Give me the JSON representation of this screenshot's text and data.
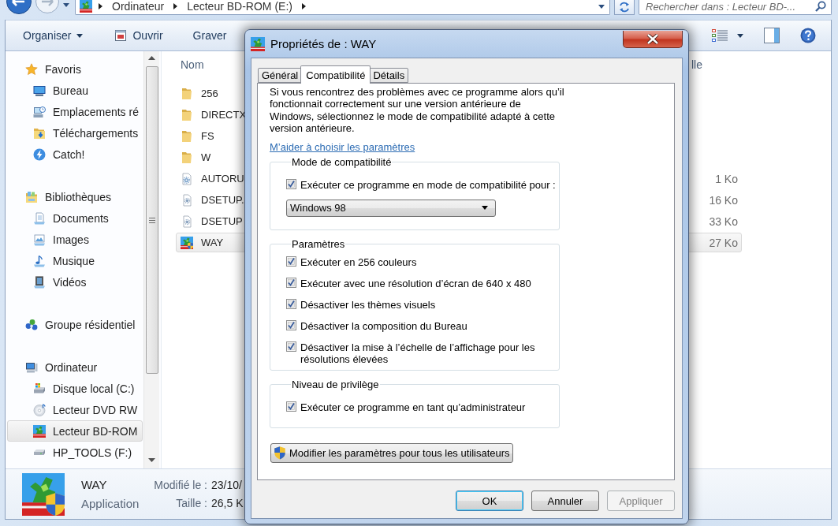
{
  "address_bar": {
    "crumbs": [
      "Ordinateur",
      "Lecteur BD-ROM (E:)"
    ],
    "search": {
      "placeholder": "Rechercher dans : Lecteur BD-..."
    }
  },
  "toolbar": {
    "items": [
      {
        "label": "Organiser",
        "kind": "menu"
      },
      {
        "label": "Ouvrir",
        "kind": "open"
      },
      {
        "label": "Graver",
        "kind": "plain"
      }
    ]
  },
  "sidebar": {
    "items": [
      {
        "label": "Favoris",
        "kind": "star",
        "selected": false,
        "children": [
          {
            "label": "Bureau",
            "kind": "desktop",
            "selected": false
          },
          {
            "label": "Emplacements ré",
            "kind": "recent",
            "selected": false
          },
          {
            "label": "Téléchargements",
            "kind": "downloads",
            "selected": false
          },
          {
            "label": "Catch!",
            "kind": "catch",
            "selected": false
          }
        ]
      },
      {
        "label": "Bibliothèques",
        "kind": "library",
        "selected": false,
        "children": [
          {
            "label": "Documents",
            "kind": "documents",
            "selected": false
          },
          {
            "label": "Images",
            "kind": "pictures",
            "selected": false
          },
          {
            "label": "Musique",
            "kind": "music",
            "selected": false
          },
          {
            "label": "Vidéos",
            "kind": "videos",
            "selected": false
          }
        ]
      },
      {
        "label": "Groupe résidentiel",
        "kind": "homegroup",
        "selected": false
      },
      {
        "label": "Ordinateur",
        "kind": "computer",
        "selected": false,
        "children": [
          {
            "label": "Disque local (C:)",
            "kind": "harddisk",
            "selected": false
          },
          {
            "label": "Lecteur DVD RW",
            "kind": "dvd",
            "selected": false
          },
          {
            "label": "Lecteur BD-ROM",
            "kind": "app",
            "selected": true
          },
          {
            "label": "HP_TOOLS (F:)",
            "kind": "drive",
            "selected": false
          }
        ]
      }
    ]
  },
  "file_list": {
    "columns": [
      "Nom",
      "lle"
    ],
    "rows": [
      {
        "name": "256",
        "kind": "folder",
        "selected": false
      },
      {
        "name": "DIRECTX",
        "kind": "folder",
        "selected": false
      },
      {
        "name": "FS",
        "kind": "folder",
        "selected": false
      },
      {
        "name": "W",
        "kind": "folder",
        "selected": false
      },
      {
        "name": "AUTORU",
        "kind": "settings",
        "size": "1 Ko",
        "selected": false
      },
      {
        "name": "DSETUP.",
        "kind": "system",
        "size": "16 Ko",
        "selected": false
      },
      {
        "name": "DSETUP",
        "kind": "system",
        "size": "33 Ko",
        "selected": false
      },
      {
        "name": "WAY",
        "kind": "app",
        "size": "27 Ko",
        "selected": true
      }
    ]
  },
  "details_pane": {
    "name": "WAY",
    "type": "Application",
    "fields": [
      {
        "label": "Modifié le :",
        "value": "23/10/"
      },
      {
        "label": "Taille :",
        "value": "26,5 K"
      }
    ]
  },
  "dialog": {
    "title": "Propriétés de : WAY",
    "tabs": [
      {
        "label": "Général",
        "selected": false
      },
      {
        "label": "Compatibilité",
        "selected": true
      },
      {
        "label": "Détails",
        "selected": false
      }
    ],
    "intro": "Si vous rencontrez des problèmes avec ce programme alors qu’il\nfonctionnait correctement sur une version antérieure de\nWindows, sélectionnez le mode de compatibilité adapté à cette\nversion antérieure.",
    "help_link": "M’aider à choisir les paramètres",
    "groups": [
      {
        "title": "Mode de compatibilité",
        "options": [
          {
            "label": "Exécuter ce programme en mode de compatibilité pour :",
            "checked": true
          }
        ],
        "select": {
          "value": "Windows 98"
        }
      },
      {
        "title": "Paramètres",
        "options": [
          {
            "label": "Exécuter en 256 couleurs",
            "checked": true
          },
          {
            "label": "Exécuter avec une résolution d’écran de 640 x 480",
            "checked": true
          },
          {
            "label": "Désactiver les thèmes visuels",
            "checked": true
          },
          {
            "label": "Désactiver la composition du Bureau",
            "checked": true
          },
          {
            "label": "Désactiver la mise à l’échelle de l’affichage pour les résolutions élevées",
            "checked": true
          }
        ]
      },
      {
        "title": "Niveau de privilège",
        "options": [
          {
            "label": "Exécuter ce programme en tant qu’administrateur",
            "checked": true
          }
        ]
      }
    ],
    "all_users_button": "Modifier les paramètres pour tous les utilisateurs",
    "buttons": [
      {
        "label": "OK",
        "default": true,
        "disabled": false
      },
      {
        "label": "Annuler",
        "default": false,
        "disabled": false
      },
      {
        "label": "Appliquer",
        "default": false,
        "disabled": true
      }
    ]
  }
}
